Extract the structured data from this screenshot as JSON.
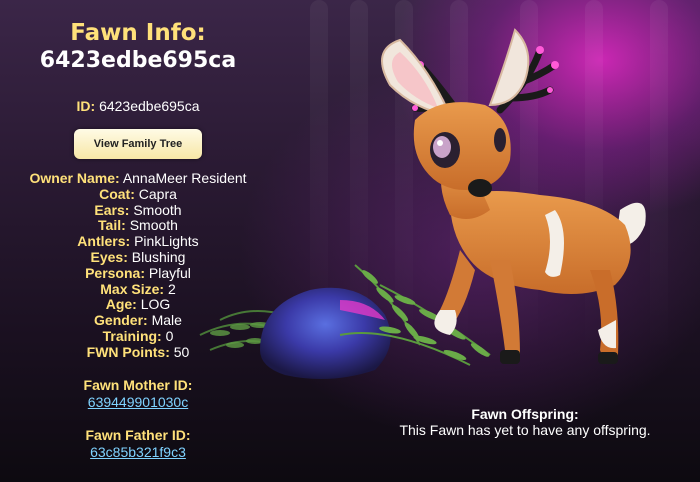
{
  "header": {
    "title": "Fawn Info:",
    "fawn_id": "6423edbe695ca"
  },
  "id_line": {
    "label": "ID:",
    "value": "6423edbe695ca"
  },
  "buttons": {
    "family_tree": "View Family Tree"
  },
  "attributes": [
    {
      "label": "Owner Name:",
      "value": "AnnaMeer Resident"
    },
    {
      "label": "Coat:",
      "value": "Capra"
    },
    {
      "label": "Ears:",
      "value": "Smooth"
    },
    {
      "label": "Tail:",
      "value": "Smooth"
    },
    {
      "label": "Antlers:",
      "value": "PinkLights"
    },
    {
      "label": "Eyes:",
      "value": "Blushing"
    },
    {
      "label": "Persona:",
      "value": "Playful"
    },
    {
      "label": "Max Size:",
      "value": "2"
    },
    {
      "label": "Age:",
      "value": "LOG"
    },
    {
      "label": "Gender:",
      "value": "Male"
    },
    {
      "label": "Training:",
      "value": "0"
    },
    {
      "label": "FWN Points:",
      "value": "50"
    }
  ],
  "parents": {
    "mother_label": "Fawn Mother ID:",
    "mother_id": "639449901030c",
    "father_label": "Fawn Father ID:",
    "father_id": "63c85b321f9c3"
  },
  "offspring": {
    "title": "Fawn Offspring:",
    "message": "This Fawn has yet to have any offspring."
  },
  "colors": {
    "label": "#ffe17a",
    "link": "#7fd3ff",
    "accent_glow": "#e628c8"
  }
}
